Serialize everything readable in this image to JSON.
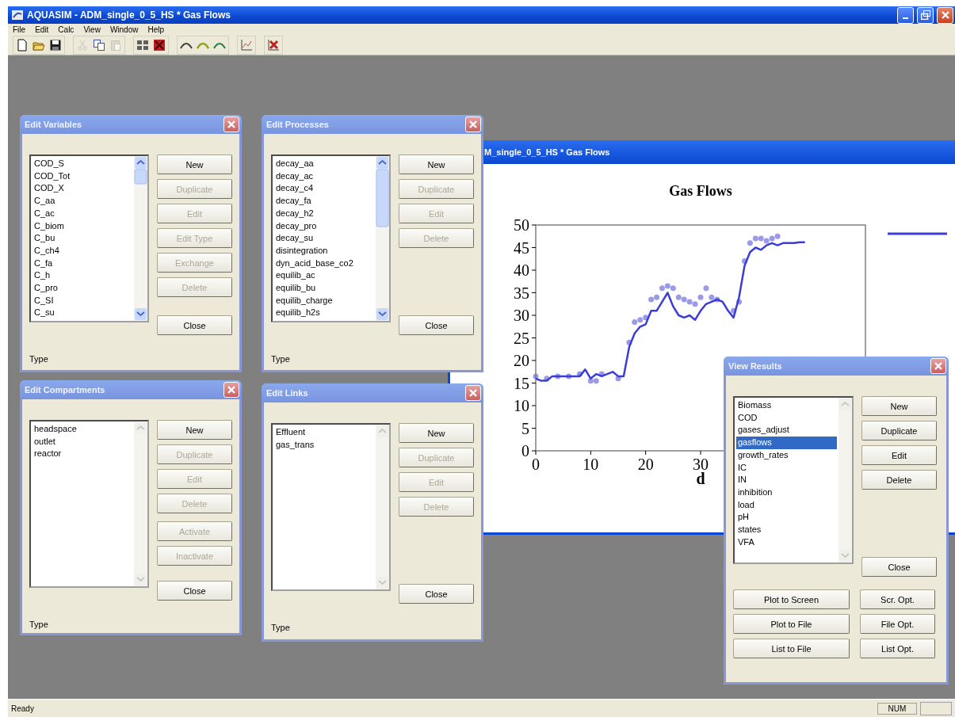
{
  "window": {
    "title": "AQUASIM - ADM_single_0_5_HS * Gas Flows"
  },
  "menu": [
    "File",
    "Edit",
    "Calc",
    "View",
    "Window",
    "Help"
  ],
  "toolbar": [
    [
      {
        "disabled": false
      },
      {
        "disabled": false
      },
      {
        "disabled": false
      }
    ],
    [
      {
        "disabled": true
      },
      {
        "disabled": false
      },
      {
        "disabled": true
      }
    ],
    [
      {
        "disabled": false
      },
      {
        "disabled": false
      }
    ],
    [
      {
        "disabled": false
      },
      {
        "disabled": false
      },
      {
        "disabled": false
      }
    ],
    [
      {
        "disabled": false
      }
    ],
    [
      {
        "disabled": false
      }
    ]
  ],
  "plot_window": {
    "title": "M_single_0_5_HS * Gas Flows",
    "chart_data": {
      "type": "line",
      "title": "Gas Flows",
      "xlabel": "d",
      "xlim": [
        0,
        60
      ],
      "ylim": [
        0,
        50
      ],
      "xticks": [
        0,
        10,
        20,
        30
      ],
      "yticks": [
        0,
        5,
        10,
        15,
        20,
        25,
        30,
        35,
        40,
        45,
        50
      ],
      "x": [
        0,
        1,
        2,
        3,
        4,
        5,
        6,
        7,
        8,
        9,
        10,
        11,
        12,
        13,
        14,
        15,
        16,
        17,
        18,
        19,
        20,
        21,
        22,
        23,
        24,
        25,
        26,
        27,
        28,
        29,
        30,
        31,
        32,
        33,
        34,
        35,
        36,
        37,
        38,
        39,
        40,
        41,
        42,
        43,
        44,
        45,
        46,
        47,
        48,
        49
      ],
      "series": [
        {
          "color": "#3c3cd8",
          "values": [
            16,
            15.5,
            15.5,
            16.5,
            16.5,
            16.5,
            16.5,
            16.5,
            16.5,
            18,
            16,
            17,
            16.5,
            17,
            17.5,
            16.5,
            16.5,
            23,
            26,
            27.5,
            28,
            31,
            31,
            33,
            35,
            32,
            30,
            29.5,
            30,
            29,
            31,
            32.5,
            33,
            33.5,
            33,
            31,
            29.5,
            34,
            41,
            44,
            45,
            44.5,
            45.5,
            46,
            45.5,
            46,
            46,
            46,
            46.2,
            46.2
          ]
        }
      ]
    },
    "overlay": {
      "chart_data": {
        "type": "scatter",
        "xlim": [
          0,
          60
        ],
        "ylim": [
          0,
          50
        ],
        "x": [
          0,
          2,
          4,
          6,
          8,
          10,
          11,
          12,
          15,
          17,
          18,
          19,
          20,
          21,
          22,
          23,
          24,
          25,
          26,
          27,
          28,
          29,
          30,
          31,
          32,
          33,
          36,
          37,
          38,
          39,
          40,
          41,
          42,
          43,
          44
        ],
        "series": [
          {
            "color": "#9a9ae8",
            "values": [
              16.5,
              16,
              16.5,
              16.5,
              17,
              15.5,
              15.5,
              17,
              16,
              24,
              28.5,
              29,
              29.5,
              33.5,
              34,
              36,
              36.5,
              36,
              34,
              33.5,
              33,
              32.5,
              34,
              36,
              34,
              33.5,
              31,
              33,
              42,
              46,
              47,
              47,
              46.5,
              47,
              47.5
            ]
          }
        ]
      }
    }
  },
  "dialogs": [
    {
      "title": "Edit Variables",
      "list": {
        "scrollable": true,
        "items": [
          {
            "label": "COD_S",
            "selected": false
          },
          {
            "label": "COD_Tot",
            "selected": false
          },
          {
            "label": "COD_X",
            "selected": false
          },
          {
            "label": "C_aa",
            "selected": false
          },
          {
            "label": "C_ac",
            "selected": false
          },
          {
            "label": "C_biom",
            "selected": false
          },
          {
            "label": "C_bu",
            "selected": false
          },
          {
            "label": "C_ch4",
            "selected": false
          },
          {
            "label": "C_fa",
            "selected": false
          },
          {
            "label": "C_h",
            "selected": false
          },
          {
            "label": "C_pro",
            "selected": false
          },
          {
            "label": "C_SI",
            "selected": false
          },
          {
            "label": "C_su",
            "selected": false
          }
        ]
      },
      "button_groups": [
        [
          {
            "label": "New",
            "disabled": false
          },
          {
            "label": "Duplicate",
            "disabled": true
          },
          {
            "label": "Edit",
            "disabled": true
          },
          {
            "label": "Edit Type",
            "disabled": true
          },
          {
            "label": "Exchange",
            "disabled": true
          },
          {
            "label": "Delete",
            "disabled": true
          }
        ],
        [
          {
            "label": "Close",
            "disabled": false
          }
        ]
      ],
      "type_label": "Type"
    },
    {
      "title": "Edit Processes",
      "list": {
        "scrollable": true,
        "items": [
          {
            "label": "decay_aa",
            "selected": false
          },
          {
            "label": "decay_ac",
            "selected": false
          },
          {
            "label": "decay_c4",
            "selected": false
          },
          {
            "label": "decay_fa",
            "selected": false
          },
          {
            "label": "decay_h2",
            "selected": false
          },
          {
            "label": "decay_pro",
            "selected": false
          },
          {
            "label": "decay_su",
            "selected": false
          },
          {
            "label": "disintegration",
            "selected": false
          },
          {
            "label": "dyn_acid_base_co2",
            "selected": false
          },
          {
            "label": "equilib_ac",
            "selected": false
          },
          {
            "label": "equilib_bu",
            "selected": false
          },
          {
            "label": "equilib_charge",
            "selected": false
          },
          {
            "label": "equilib_h2s",
            "selected": false
          }
        ]
      },
      "button_groups": [
        [
          {
            "label": "New",
            "disabled": false
          },
          {
            "label": "Duplicate",
            "disabled": true
          },
          {
            "label": "Edit",
            "disabled": true
          },
          {
            "label": "Delete",
            "disabled": true
          }
        ],
        [
          {
            "label": "Close",
            "disabled": false
          }
        ]
      ],
      "type_label": "Type"
    },
    {
      "title": "Edit Compartments",
      "list": {
        "scrollable": false,
        "items": [
          {
            "label": "headspace",
            "selected": false
          },
          {
            "label": "outlet",
            "selected": false
          },
          {
            "label": "reactor",
            "selected": false
          }
        ]
      },
      "button_groups": [
        [
          {
            "label": "New",
            "disabled": false
          },
          {
            "label": "Duplicate",
            "disabled": true
          },
          {
            "label": "Edit",
            "disabled": true
          },
          {
            "label": "Delete",
            "disabled": true
          }
        ],
        [
          {
            "label": "Activate",
            "disabled": true
          },
          {
            "label": "Inactivate",
            "disabled": true
          }
        ],
        [
          {
            "label": "Close",
            "disabled": false
          }
        ]
      ],
      "type_label": "Type"
    },
    {
      "title": "Edit Links",
      "list": {
        "scrollable": false,
        "items": [
          {
            "label": "Effluent",
            "selected": false
          },
          {
            "label": "gas_trans",
            "selected": false
          }
        ]
      },
      "button_groups": [
        [
          {
            "label": "New",
            "disabled": false
          },
          {
            "label": "Duplicate",
            "disabled": true
          },
          {
            "label": "Edit",
            "disabled": true
          },
          {
            "label": "Delete",
            "disabled": true
          }
        ],
        [
          {
            "label": "Close",
            "disabled": false
          }
        ]
      ],
      "type_label": "Type"
    },
    {
      "title": "View Results",
      "list": {
        "scrollable": false,
        "items": [
          {
            "label": "Biomass",
            "selected": false
          },
          {
            "label": "COD",
            "selected": false
          },
          {
            "label": "gases_adjust",
            "selected": false
          },
          {
            "label": "gasflows",
            "selected": true
          },
          {
            "label": "growth_rates",
            "selected": false
          },
          {
            "label": "IC",
            "selected": false
          },
          {
            "label": "IN",
            "selected": false
          },
          {
            "label": "inhibition",
            "selected": false
          },
          {
            "label": "load",
            "selected": false
          },
          {
            "label": "pH",
            "selected": false
          },
          {
            "label": "states",
            "selected": false
          },
          {
            "label": "VFA",
            "selected": false
          }
        ]
      },
      "button_groups": [
        [
          {
            "label": "New",
            "disabled": false
          },
          {
            "label": "Duplicate",
            "disabled": false
          },
          {
            "label": "Edit",
            "disabled": false
          },
          {
            "label": "Delete",
            "disabled": false
          }
        ],
        [
          {
            "label": "Close",
            "disabled": false
          }
        ]
      ],
      "action_rows": [
        [
          {
            "label": "Plot to Screen",
            "disabled": false
          },
          {
            "label": "Scr. Opt.",
            "disabled": false
          }
        ],
        [
          {
            "label": "Plot to File",
            "disabled": false
          },
          {
            "label": "File Opt.",
            "disabled": false
          }
        ],
        [
          {
            "label": "List to File",
            "disabled": false
          },
          {
            "label": "List Opt.",
            "disabled": false
          }
        ]
      ]
    }
  ],
  "status_bar": {
    "text": "Ready",
    "panels": [
      "NUM"
    ]
  }
}
